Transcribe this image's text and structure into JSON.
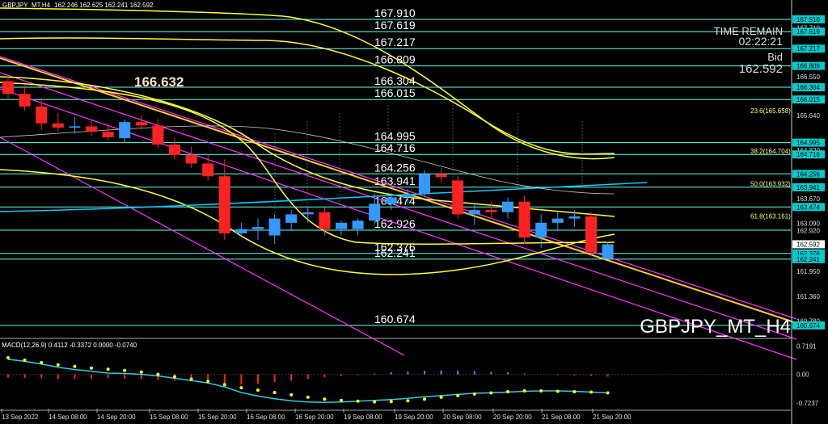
{
  "header": {
    "symbol_line": "GBPJPY_MT,H4",
    "ohlc_line": "162.246 162.625 162.241 162.592"
  },
  "overlay": {
    "time_remain_label": "TIME REMAIN",
    "time_remain_value": "02:22:21",
    "bid_label": "Bid",
    "bid_value": "162.592",
    "watermark": "GBPJPY_MT_H4",
    "high_mark": "166.632"
  },
  "colors": {
    "background": "#000000",
    "bull": "#3399ff",
    "bear": "#ff2222",
    "level_line": "#66ffee",
    "bollinger": "#ffff33",
    "channel": "#ff33ff",
    "trendline": "#ffcc33",
    "macd_signal": "#33ccdd",
    "macd_dots": "#ffff00"
  },
  "chart_data": {
    "type": "candlestick",
    "ylim": [
      160.5,
      168.1
    ],
    "levels": [
      {
        "value": 167.91,
        "label": "167.910"
      },
      {
        "value": 167.619,
        "label": "167.619"
      },
      {
        "value": 167.217,
        "label": "167.217"
      },
      {
        "value": 166.809,
        "label": "166.809"
      },
      {
        "value": 166.304,
        "label": "166.304"
      },
      {
        "value": 166.015,
        "label": "166.015"
      },
      {
        "value": 164.995,
        "label": "164.995"
      },
      {
        "value": 164.716,
        "label": "164.716"
      },
      {
        "value": 164.256,
        "label": "164.256"
      },
      {
        "value": 163.941,
        "label": "163.941"
      },
      {
        "value": 163.474,
        "label": "163.474"
      },
      {
        "value": 162.926,
        "label": "162.926"
      },
      {
        "value": 162.376,
        "label": "162.376"
      },
      {
        "value": 162.241,
        "label": "162.241"
      },
      {
        "value": 160.674,
        "label": "160.674"
      }
    ],
    "fib_levels": [
      {
        "value": 165.658,
        "label": "23.6(165.658)"
      },
      {
        "value": 164.704,
        "label": "38.2(164.704)"
      },
      {
        "value": 163.932,
        "label": "50.0(163.932)"
      },
      {
        "value": 163.161,
        "label": "61.8(163.161)"
      }
    ],
    "y_ticks": [
      "167.910",
      "167.710",
      "167.619",
      "167.217",
      "166.809",
      "166.550",
      "166.304",
      "166.015",
      "165.640",
      "164.995",
      "164.820",
      "164.716",
      "164.256",
      "163.941",
      "163.670",
      "163.474",
      "163.090",
      "162.920",
      "162.592",
      "162.376",
      "162.241",
      "161.950",
      "161.360",
      "160.780",
      "160.674"
    ],
    "x_labels": [
      "13 Sep 2022",
      "14 Sep 08:00",
      "14 Sep 20:00",
      "15 Sep 08:00",
      "15 Sep 20:00",
      "16 Sep 08:00",
      "16 Sep 20:00",
      "19 Sep 08:00",
      "19 Sep 20:00",
      "20 Sep 08:00",
      "20 Sep 20:00",
      "21 Sep 08:00",
      "21 Sep 20:00"
    ],
    "candles": [
      {
        "o": 166.45,
        "h": 166.55,
        "l": 166.05,
        "c": 166.15
      },
      {
        "o": 166.15,
        "h": 166.35,
        "l": 165.75,
        "c": 165.85
      },
      {
        "o": 165.85,
        "h": 166.05,
        "l": 165.3,
        "c": 165.45
      },
      {
        "o": 165.45,
        "h": 165.7,
        "l": 165.25,
        "c": 165.35
      },
      {
        "o": 165.35,
        "h": 165.6,
        "l": 165.2,
        "c": 165.38
      },
      {
        "o": 165.38,
        "h": 165.55,
        "l": 165.15,
        "c": 165.25
      },
      {
        "o": 165.25,
        "h": 165.45,
        "l": 165.05,
        "c": 165.12
      },
      {
        "o": 165.1,
        "h": 165.55,
        "l": 165.0,
        "c": 165.48
      },
      {
        "o": 165.48,
        "h": 165.65,
        "l": 165.3,
        "c": 165.4
      },
      {
        "o": 165.4,
        "h": 165.55,
        "l": 164.85,
        "c": 164.95
      },
      {
        "o": 164.95,
        "h": 165.1,
        "l": 164.6,
        "c": 164.7
      },
      {
        "o": 164.7,
        "h": 164.9,
        "l": 164.4,
        "c": 164.5
      },
      {
        "o": 164.5,
        "h": 164.7,
        "l": 164.1,
        "c": 164.2
      },
      {
        "o": 164.2,
        "h": 164.6,
        "l": 162.7,
        "c": 162.85
      },
      {
        "o": 162.85,
        "h": 163.1,
        "l": 162.75,
        "c": 162.95
      },
      {
        "o": 162.95,
        "h": 163.2,
        "l": 162.7,
        "c": 163.0
      },
      {
        "o": 162.8,
        "h": 163.3,
        "l": 162.6,
        "c": 163.2
      },
      {
        "o": 163.1,
        "h": 163.4,
        "l": 162.9,
        "c": 163.3
      },
      {
        "o": 163.3,
        "h": 163.45,
        "l": 163.1,
        "c": 163.35
      },
      {
        "o": 163.35,
        "h": 163.45,
        "l": 162.8,
        "c": 162.95
      },
      {
        "o": 162.95,
        "h": 163.15,
        "l": 162.8,
        "c": 163.1
      },
      {
        "o": 162.95,
        "h": 163.2,
        "l": 162.8,
        "c": 163.15
      },
      {
        "o": 163.15,
        "h": 163.8,
        "l": 163.05,
        "c": 163.55
      },
      {
        "o": 163.55,
        "h": 163.8,
        "l": 163.4,
        "c": 163.7
      },
      {
        "o": 163.7,
        "h": 163.9,
        "l": 163.55,
        "c": 163.78
      },
      {
        "o": 163.78,
        "h": 164.35,
        "l": 163.7,
        "c": 164.25
      },
      {
        "o": 164.25,
        "h": 164.4,
        "l": 164.05,
        "c": 164.18
      },
      {
        "o": 164.1,
        "h": 164.2,
        "l": 163.2,
        "c": 163.3
      },
      {
        "o": 163.3,
        "h": 163.55,
        "l": 163.05,
        "c": 163.4
      },
      {
        "o": 163.4,
        "h": 163.6,
        "l": 163.2,
        "c": 163.35
      },
      {
        "o": 163.35,
        "h": 163.7,
        "l": 163.2,
        "c": 163.6
      },
      {
        "o": 163.6,
        "h": 163.75,
        "l": 162.6,
        "c": 162.75
      },
      {
        "o": 162.75,
        "h": 163.3,
        "l": 162.5,
        "c": 163.1
      },
      {
        "o": 163.1,
        "h": 163.35,
        "l": 162.9,
        "c": 163.2
      },
      {
        "o": 163.2,
        "h": 163.4,
        "l": 163.0,
        "c": 163.25
      },
      {
        "o": 163.25,
        "h": 163.35,
        "l": 162.3,
        "c": 162.4
      },
      {
        "o": 162.25,
        "h": 162.65,
        "l": 162.24,
        "c": 162.59
      }
    ],
    "macd": {
      "label": "MACD(12,26,9) 0.4112 -0.3372 0.0000 -0.0740",
      "ticks": [
        "0.7191",
        "0.00",
        "-0.7237"
      ],
      "ylim": [
        -0.85,
        0.85
      ],
      "signal": [
        0.38,
        0.33,
        0.26,
        0.18,
        0.12,
        0.08,
        0.03,
        0.02,
        0.0,
        -0.04,
        -0.1,
        -0.16,
        -0.22,
        -0.32,
        -0.46,
        -0.55,
        -0.62,
        -0.67,
        -0.7,
        -0.71,
        -0.7,
        -0.68,
        -0.66,
        -0.64,
        -0.61,
        -0.57,
        -0.54,
        -0.51,
        -0.48,
        -0.47,
        -0.45,
        -0.43,
        -0.42,
        -0.42,
        -0.43,
        -0.45,
        -0.47
      ],
      "dots": [
        0.42,
        0.36,
        0.3,
        0.24,
        0.2,
        0.16,
        0.13,
        0.1,
        0.06,
        0.0,
        -0.06,
        -0.12,
        -0.18,
        -0.26,
        -0.34,
        -0.4,
        -0.46,
        -0.52,
        -0.58,
        -0.63,
        -0.66,
        -0.68,
        -0.7,
        -0.69,
        -0.67,
        -0.63,
        -0.58,
        -0.54,
        -0.5,
        -0.47,
        -0.44,
        -0.42,
        -0.42,
        -0.43,
        -0.44,
        -0.45,
        -0.47
      ],
      "hist": [
        -0.08,
        -0.09,
        -0.1,
        -0.12,
        -0.12,
        -0.11,
        -0.1,
        -0.11,
        -0.12,
        -0.14,
        -0.15,
        -0.17,
        -0.18,
        -0.22,
        -0.26,
        -0.24,
        -0.2,
        -0.16,
        -0.12,
        -0.08,
        -0.04,
        -0.02,
        0.02,
        0.05,
        0.07,
        0.09,
        0.1,
        0.09,
        0.08,
        0.06,
        0.05,
        0.02,
        -0.01,
        -0.02,
        -0.03,
        -0.04,
        -0.06
      ]
    }
  }
}
